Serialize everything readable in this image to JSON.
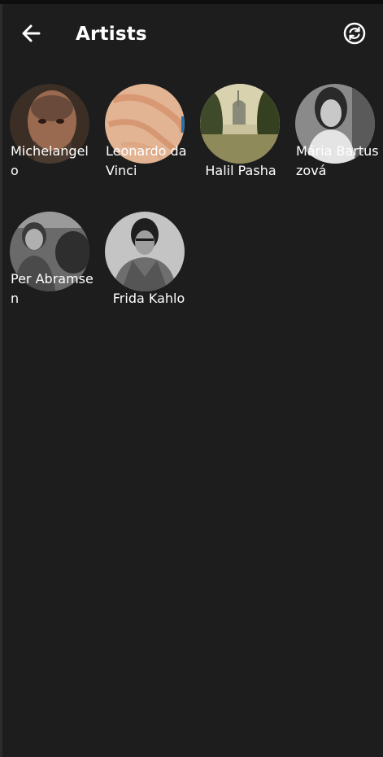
{
  "header": {
    "title": "Artists",
    "back_icon": "arrow-left-icon",
    "sync_icon": "sync-icon"
  },
  "artists": [
    {
      "name": "Michelangelo"
    },
    {
      "name": "Leonardo da Vinci"
    },
    {
      "name": "Halil Pasha"
    },
    {
      "name": "Mária Bartuszová"
    },
    {
      "name": "Per Abramsen"
    },
    {
      "name": "Frida Kahlo"
    }
  ]
}
